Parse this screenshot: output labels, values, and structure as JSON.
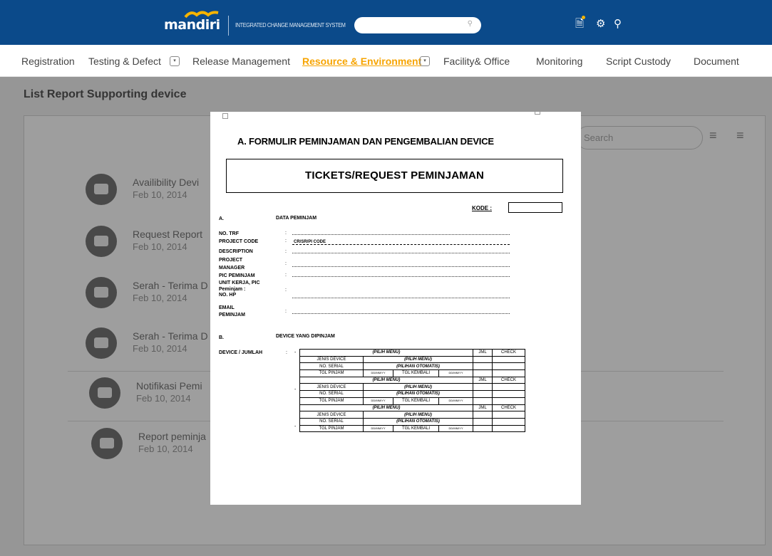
{
  "topbar": {
    "logo": "mandiri",
    "system_name": "INTEGRATED CHANGE MANAGEMENT SYSTEM",
    "search_placeholder": "",
    "icons": [
      "document-notification-icon",
      "settings-icon",
      "user-icon"
    ],
    "colors": {
      "bar": "#0b4a8a",
      "accent": "#f7a400"
    }
  },
  "menu": {
    "items": [
      {
        "label": "Registration",
        "dropdown": false,
        "active": false
      },
      {
        "label": "Testing & Defect",
        "dropdown": true,
        "active": false
      },
      {
        "label": "Release  Management",
        "dropdown": false,
        "active": false
      },
      {
        "label": "Resource & Environment",
        "dropdown": true,
        "active": true
      },
      {
        "label": "Facility& Office",
        "dropdown": false,
        "active": false
      },
      {
        "label": "Monitoring",
        "dropdown": false,
        "active": false
      },
      {
        "label": "Script Custody",
        "dropdown": false,
        "active": false
      },
      {
        "label": "Document",
        "dropdown": false,
        "active": false
      }
    ]
  },
  "page": {
    "title": "List Report Supporting device",
    "search_placeholder": "Search"
  },
  "reports": [
    {
      "title": "Availibility Devi",
      "date": "Feb 10, 2014"
    },
    {
      "title": "Request Report",
      "date": "Feb 10, 2014"
    },
    {
      "title": "Serah - Terima D",
      "date": "Feb 10, 2014"
    },
    {
      "title": "Serah - Terima D",
      "date": "Feb 10, 2014"
    },
    {
      "title": "Notifikasi Pemi",
      "date": "Feb 10, 2014"
    },
    {
      "title": "Report peminja",
      "date": "Feb 10, 2014"
    }
  ],
  "document": {
    "title": "A. FORMULIR PEMINJAMAN DAN PENGEMBALIAN DEVICE",
    "ticket_heading": "TICKETS/REQUEST PEMINJAMAN",
    "kode_label": "KODE :",
    "section_a_num": "A.",
    "section_a_title": "DATA PEMINJAM",
    "fields": [
      {
        "label": "NO. TRF",
        "colon": ":"
      },
      {
        "label": "PROJECT CODE",
        "colon": ":"
      },
      {
        "label": "DESCRIPTION",
        "colon": ":"
      },
      {
        "label": "PROJECT",
        "colon": ":"
      },
      {
        "label": "MANAGER",
        "colon": ""
      },
      {
        "label": "PIC PEMINJAM",
        "colon": ":"
      },
      {
        "label": "UNIT KERJA, PIC",
        "colon": ""
      },
      {
        "label": "Peminjam :",
        "colon": ":"
      },
      {
        "label": "NO. HP",
        "colon": ""
      },
      {
        "label": "EMAIL",
        "colon": ":"
      },
      {
        "label": "PEMINJAM",
        "colon": ""
      }
    ],
    "project_code_value": "CR/SR/PI CODE",
    "section_b_num": "B.",
    "section_b_title": "DEVICE YANG DIPINJAM",
    "device_label": "DEVICE / JUMLAH",
    "device_colon": ":",
    "dash": "-",
    "table": {
      "pilih_menu": "(PILIH MENU)",
      "jml": "JML",
      "check": "CHECK",
      "jenis_device": "JENIS DEVICE",
      "no_serial": "NO. SERIAL",
      "pilihan_otomatis": "(PILIHAN OTOMATIS)",
      "tgl_pinjam": "TGL PINJAM",
      "tgl_kembali": "TGL KEMBALI",
      "date_fmt": "DD/MM/YY"
    }
  }
}
